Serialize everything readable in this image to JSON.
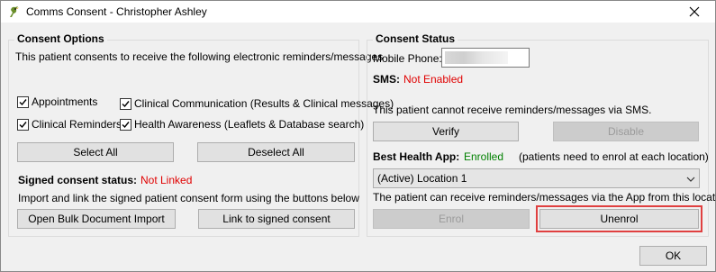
{
  "window": {
    "title": "Comms Consent - Christopher Ashley"
  },
  "consent_options": {
    "title": "Consent Options",
    "description": "This patient consents to receive the following electronic reminders/messages",
    "checkboxes": [
      {
        "label": "Appointments",
        "checked": true
      },
      {
        "label": "Clinical Communication (Results & Clinical messages)",
        "checked": true
      },
      {
        "label": "Clinical Reminders",
        "checked": true
      },
      {
        "label": "Health Awareness (Leaflets & Database search)",
        "checked": true
      }
    ],
    "select_all_label": "Select All",
    "deselect_all_label": "Deselect All",
    "signed_status_label": "Signed consent status:",
    "signed_status_value": "Not Linked",
    "signed_description": "Import and link the signed patient consent form using the buttons below",
    "bulk_import_label": "Open Bulk Document Import",
    "link_signed_label": "Link to signed consent"
  },
  "consent_status": {
    "title": "Consent Status",
    "mobile_label": "Mobile Phone:",
    "sms_label": "SMS:",
    "sms_value": "Not Enabled",
    "sms_description": "This patient cannot receive reminders/messages via SMS.",
    "verify_label": "Verify",
    "disable_label": "Disable",
    "app_label": "Best Health App:",
    "app_value": "Enrolled",
    "app_note": "(patients need to enrol at each location)",
    "location_selected": "(Active) Location 1",
    "app_description": "The patient can receive reminders/messages via the App from this location.",
    "enrol_label": "Enrol",
    "unenrol_label": "Unenrol"
  },
  "footer": {
    "ok_label": "OK"
  },
  "colors": {
    "accent_red": "#e00000",
    "status_green": "#008000",
    "highlight": "#e04040"
  },
  "icons": {
    "app": "bird-icon",
    "close": "close-icon",
    "check": "check-icon",
    "dropdown": "chevron-down-icon"
  }
}
